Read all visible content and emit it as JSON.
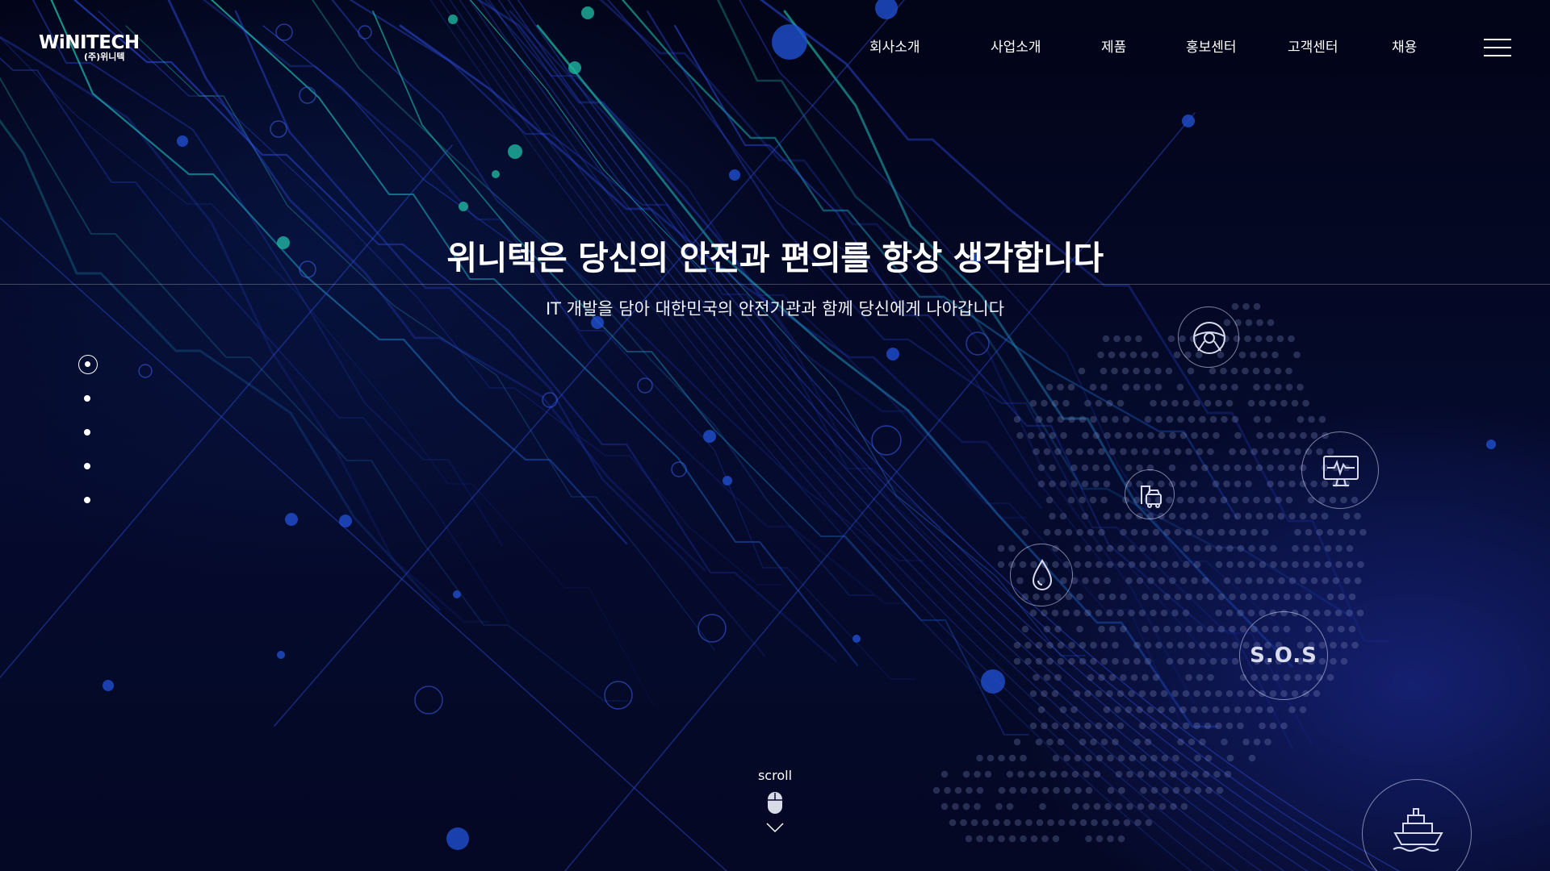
{
  "brand": {
    "logo_main": "WiNITECH",
    "logo_sub": "(주)위니텍"
  },
  "nav": {
    "items": [
      {
        "label": "회사소개"
      },
      {
        "label": "사업소개"
      },
      {
        "label": "제품"
      },
      {
        "label": "홍보센터"
      },
      {
        "label": "고객센터"
      },
      {
        "label": "채용"
      }
    ],
    "menu_icon": "hamburger-menu-icon"
  },
  "hero": {
    "title": "위니텍은 당신의 안전과 편의를 항상 생각합니다",
    "subtitle": "IT 개발을 담아 대한민국의 안전기관과 함께 당신에게 나아갑니다"
  },
  "pagination": {
    "total": 5,
    "active_index": 0
  },
  "scroll": {
    "label": "scroll",
    "icons": [
      "mouse-icon",
      "chevron-down-icon"
    ]
  },
  "features": [
    {
      "icon": "steering-wheel-icon"
    },
    {
      "icon": "monitor-heartbeat-icon"
    },
    {
      "icon": "vehicle-icon"
    },
    {
      "icon": "water-drop-icon"
    },
    {
      "icon": "sos-icon",
      "label": "S.O.S"
    },
    {
      "icon": "ship-icon"
    }
  ],
  "colors": {
    "background": "#03061a",
    "accent_teal": "#1fb5a0",
    "accent_blue": "#2a44d8",
    "text": "#ffffff"
  }
}
